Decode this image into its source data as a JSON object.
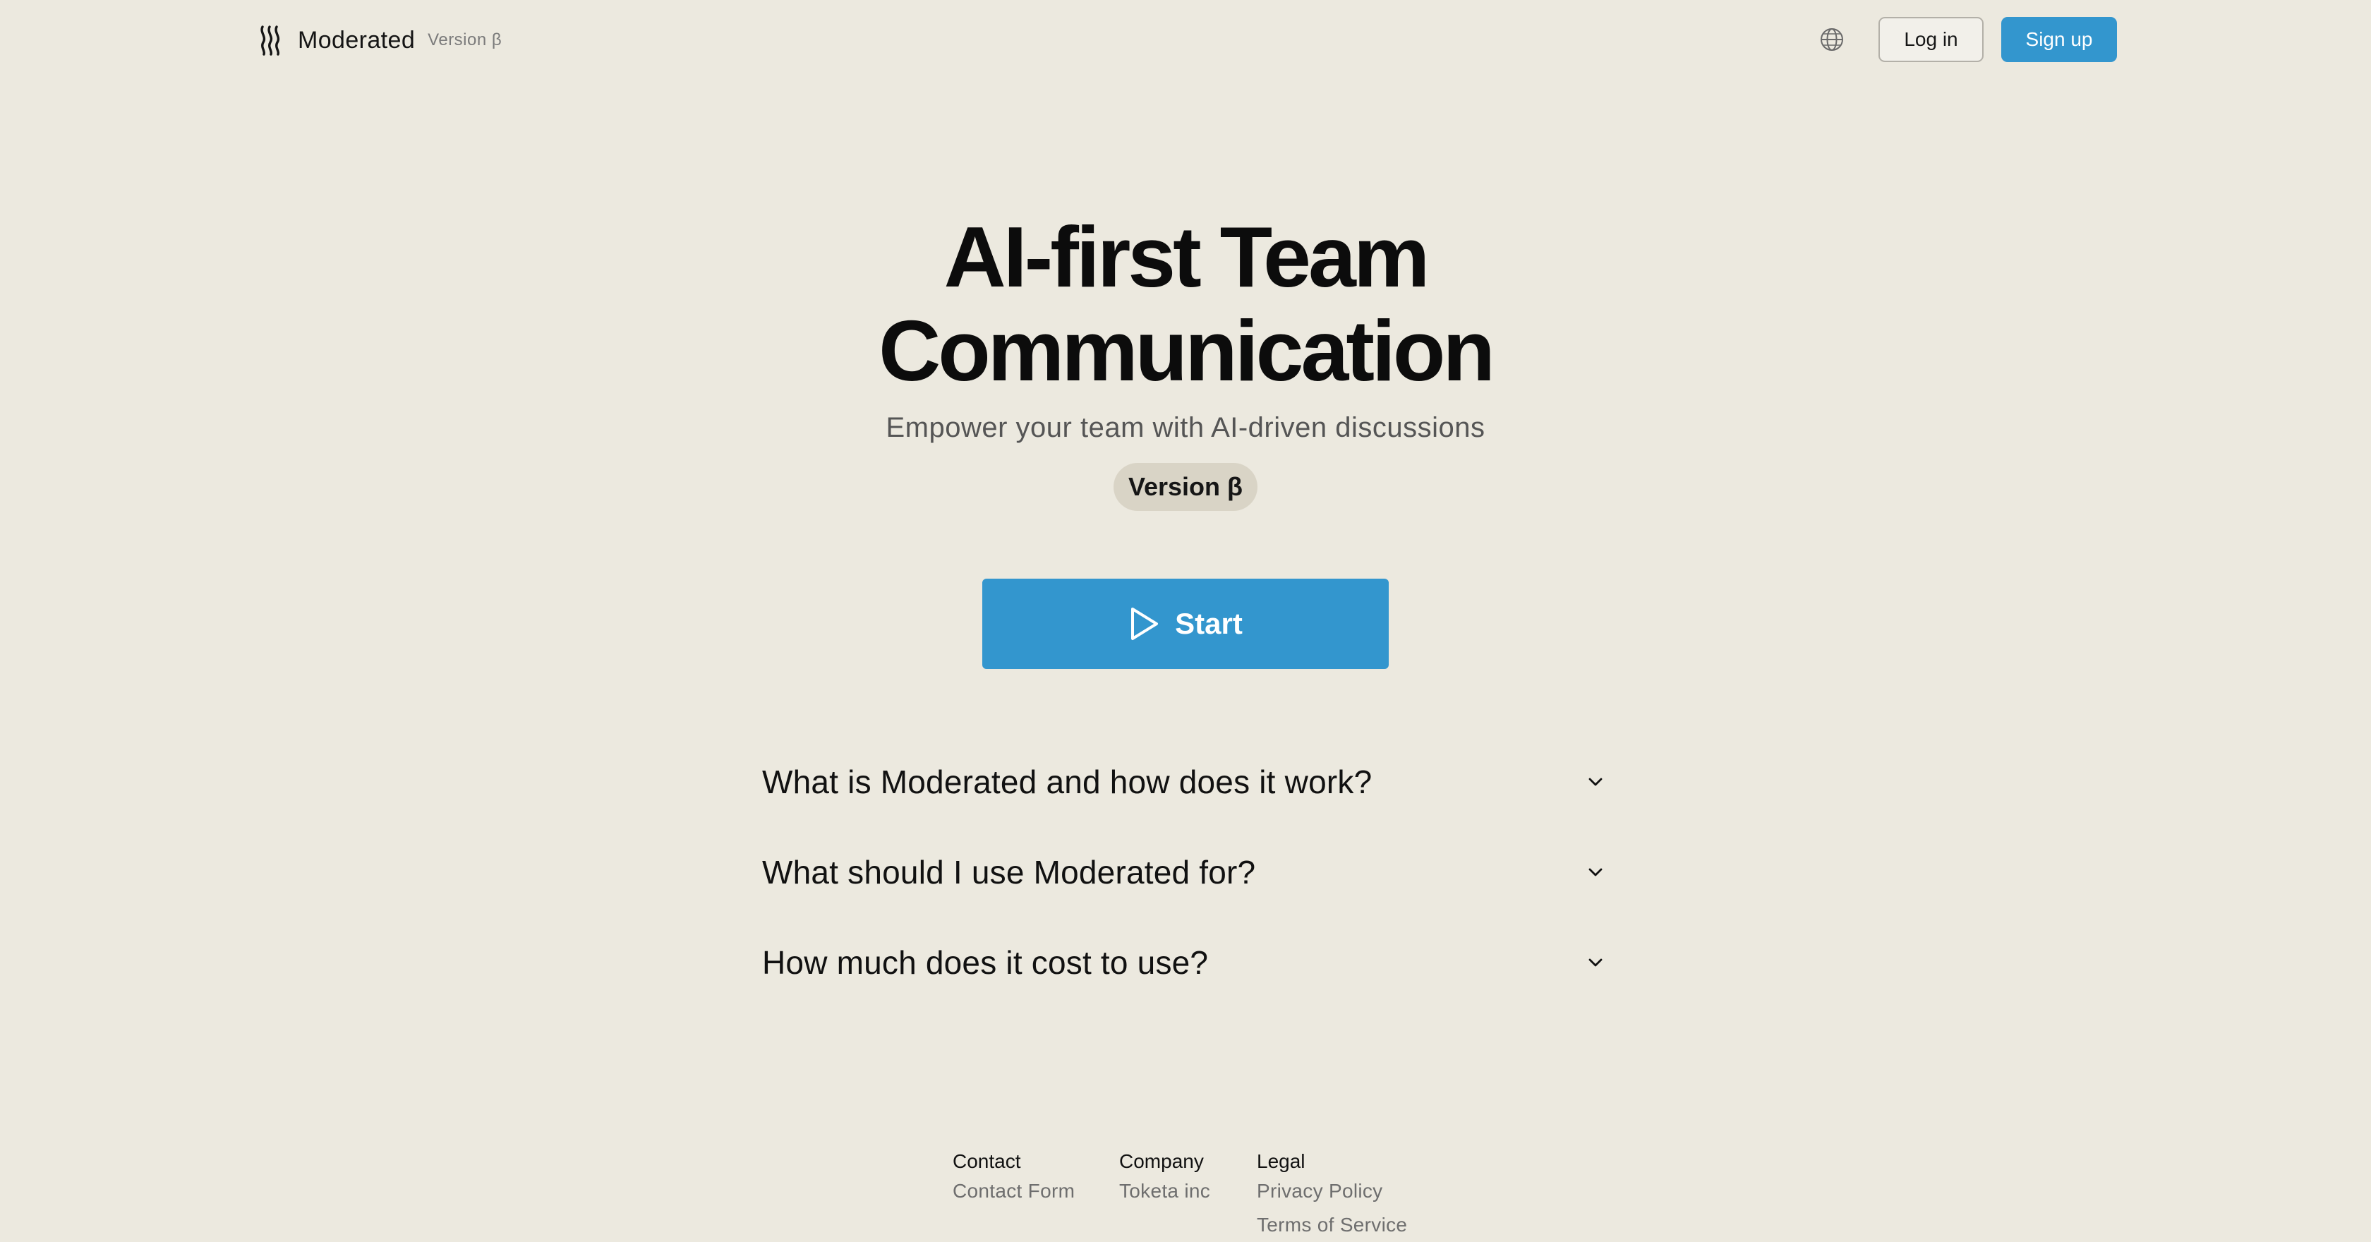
{
  "header": {
    "brand_name": "Moderated",
    "brand_version": "Version β",
    "login_label": "Log in",
    "signup_label": "Sign up",
    "globe_icon": "globe-icon"
  },
  "hero": {
    "title_line1": "AI-first Team",
    "title_line2": "Communication",
    "subtitle": "Empower your team with AI-driven discussions",
    "badge": "Version β",
    "start_label": "Start",
    "start_icon": "play-icon"
  },
  "faq": {
    "items": [
      {
        "question": "What is Moderated and how does it work?"
      },
      {
        "question": "What should I use Moderated for?"
      },
      {
        "question": "How much does it cost to use?"
      }
    ],
    "chevron_icon": "chevron-down-icon"
  },
  "footer": {
    "contact": {
      "heading": "Contact",
      "links": [
        "Contact Form"
      ]
    },
    "company": {
      "heading": "Company",
      "links": [
        "Toketa inc"
      ]
    },
    "legal": {
      "heading": "Legal",
      "links": [
        "Privacy Policy",
        "Terms of Service"
      ]
    }
  },
  "colors": {
    "background": "#ECE9DF",
    "accent": "#3396CE",
    "badge_bg": "#D9D4C6"
  }
}
